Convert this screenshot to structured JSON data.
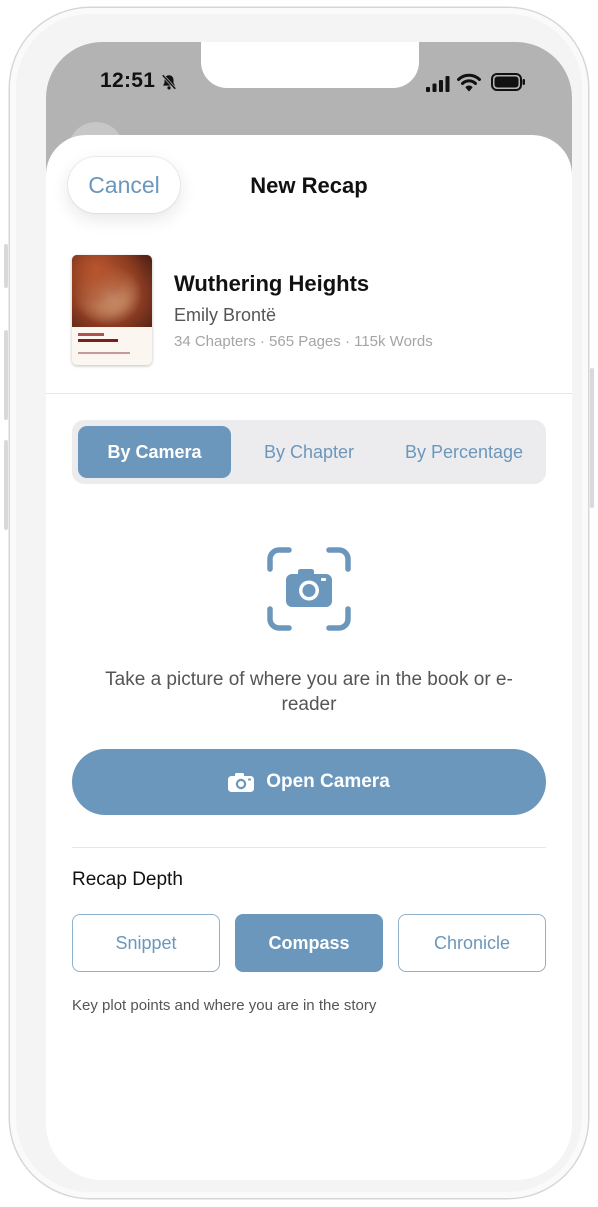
{
  "status_bar": {
    "time": "12:51",
    "icons": [
      "bell-slash-icon",
      "cellular-signal-icon",
      "wifi-icon",
      "battery-icon"
    ]
  },
  "header": {
    "cancel_label": "Cancel",
    "title": "New Recap"
  },
  "book": {
    "title": "Wuthering Heights",
    "author": "Emily Brontë",
    "meta": "34 Chapters · 565 Pages · 115k Words"
  },
  "mode_tabs": {
    "items": [
      {
        "label": "By Camera",
        "active": true
      },
      {
        "label": "By Chapter",
        "active": false
      },
      {
        "label": "By Percentage",
        "active": false
      }
    ]
  },
  "camera": {
    "icon": "camera-viewfinder-icon",
    "instruction": "Take a picture of where you are in the book or e-reader",
    "button_label": "Open Camera",
    "button_icon": "camera-icon"
  },
  "recap_depth": {
    "label": "Recap Depth",
    "options": [
      {
        "label": "Snippet",
        "active": false
      },
      {
        "label": "Compass",
        "active": true
      },
      {
        "label": "Chronicle",
        "active": false
      }
    ],
    "description": "Key plot points and where you are in the story"
  },
  "colors": {
    "accent": "#6b97bc",
    "segment_bg": "#ececee",
    "text_primary": "#111111",
    "text_secondary": "#555555",
    "text_muted": "#a5a5a8"
  }
}
